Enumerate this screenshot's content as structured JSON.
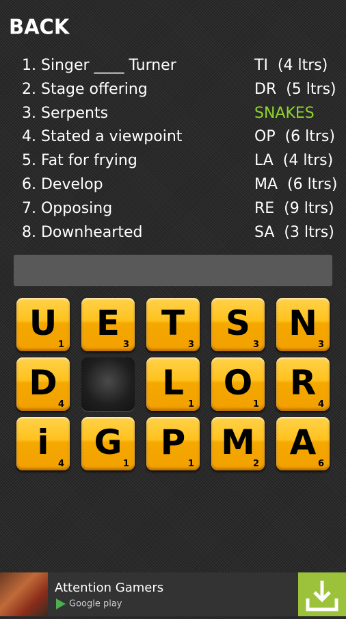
{
  "header": {
    "back_label": "BACK"
  },
  "clues": [
    {
      "question": "1. Singer ____ Turner",
      "hint": "TI  (4 ltrs)",
      "solved": false
    },
    {
      "question": "2. Stage offering",
      "hint": "DR  (5 ltrs)",
      "solved": false
    },
    {
      "question": "3. Serpents",
      "hint": "SNAKES",
      "solved": true
    },
    {
      "question": "4. Stated a viewpoint",
      "hint": "OP  (6 ltrs)",
      "solved": false
    },
    {
      "question": "5. Fat for frying",
      "hint": "LA  (4 ltrs)",
      "solved": false
    },
    {
      "question": "6. Develop",
      "hint": "MA  (6 ltrs)",
      "solved": false
    },
    {
      "question": "7. Opposing",
      "hint": "RE  (9 ltrs)",
      "solved": false
    },
    {
      "question": "8. Downhearted",
      "hint": "SA  (3 ltrs)",
      "solved": false
    }
  ],
  "answer_input": {
    "value": ""
  },
  "tiles": [
    {
      "letter": "U",
      "points": "1"
    },
    {
      "letter": "E",
      "points": "3"
    },
    {
      "letter": "T",
      "points": "3"
    },
    {
      "letter": "S",
      "points": "3"
    },
    {
      "letter": "N",
      "points": "3"
    },
    {
      "letter": "D",
      "points": "4"
    },
    {
      "letter": "",
      "points": "",
      "empty": true
    },
    {
      "letter": "L",
      "points": "1"
    },
    {
      "letter": "O",
      "points": "1"
    },
    {
      "letter": "R",
      "points": "4"
    },
    {
      "letter": "i",
      "points": "4"
    },
    {
      "letter": "G",
      "points": "1"
    },
    {
      "letter": "P",
      "points": "1"
    },
    {
      "letter": "M",
      "points": "2"
    },
    {
      "letter": "A",
      "points": "6"
    }
  ],
  "colors": {
    "solved": "#8fd62a",
    "tile": "#ffc21e",
    "ad_download": "#9bc23a"
  },
  "ad": {
    "title": "Attention Gamers",
    "store": "Google play",
    "download_icon": "download-icon"
  }
}
